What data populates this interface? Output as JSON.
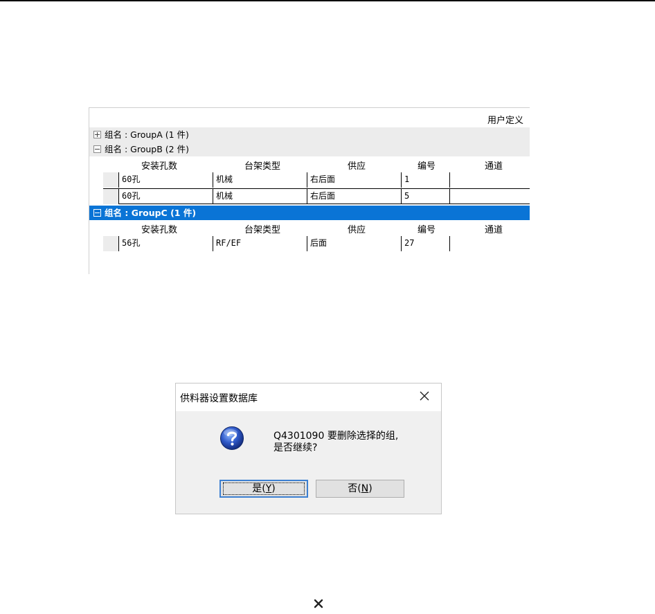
{
  "grid": {
    "header_label": "用户定义",
    "columns": [
      "安装孔数",
      "台架类型",
      "供应",
      "编号",
      "通道"
    ],
    "groups": [
      {
        "label": "组名 : GroupA (1 件)",
        "expanded": false,
        "selected": false,
        "rows": []
      },
      {
        "label": "组名 : GroupB (2 件)",
        "expanded": true,
        "selected": false,
        "rows": [
          [
            "60孔",
            "机械",
            "右后面",
            "1",
            ""
          ],
          [
            "60孔",
            "机械",
            "右后面",
            "5",
            ""
          ]
        ]
      },
      {
        "label": "组名 : GroupC (1 件)",
        "expanded": true,
        "selected": true,
        "rows": [
          [
            "56孔",
            "RF/EF",
            "后面",
            "27",
            ""
          ]
        ]
      }
    ]
  },
  "dialog": {
    "title": "供料器设置数据库",
    "message_line1": "Q4301090 要删除选择的组,",
    "message_line2": "是否继续?",
    "yes_label": "是(",
    "yes_key": "Y",
    "no_label": "否(",
    "no_key": "N",
    "close_symbol": "✕",
    "icon": "question-icon"
  },
  "bottom_icon": "close-icon",
  "colors": {
    "selected_group": "#0a74d6",
    "group_bg": "#ececec",
    "dialog_bg": "#f0f0f0"
  }
}
